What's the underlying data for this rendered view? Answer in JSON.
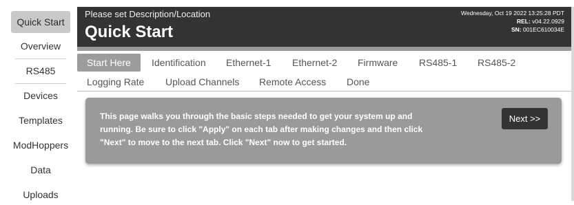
{
  "sidebar": {
    "items": [
      {
        "label": "Quick Start",
        "active": true
      },
      {
        "label": "Overview"
      },
      {
        "label": "RS485"
      },
      {
        "label": "Devices"
      },
      {
        "label": "Templates"
      },
      {
        "label": "ModHoppers"
      },
      {
        "label": "Data"
      },
      {
        "label": "Uploads"
      }
    ]
  },
  "header": {
    "subtitle": "Please set Description/Location",
    "title": "Quick Start",
    "datetime": "Wednesday, Oct 19 2022 13:25:28 PDT",
    "rel_label": "REL:",
    "rel_value": "v04.22.0929",
    "sn_label": "SN:",
    "sn_value": "001EC610034E"
  },
  "tabs": [
    {
      "label": "Start Here",
      "active": true
    },
    {
      "label": "Identification"
    },
    {
      "label": "Ethernet-1"
    },
    {
      "label": "Ethernet-2"
    },
    {
      "label": "Firmware"
    },
    {
      "label": "RS485-1"
    },
    {
      "label": "RS485-2"
    },
    {
      "label": "Logging Rate"
    },
    {
      "label": "Upload Channels"
    },
    {
      "label": "Remote Access"
    },
    {
      "label": "Done"
    }
  ],
  "panel": {
    "line1": "This page walks you through the basic steps needed to get your system up and",
    "line2": "running. Be sure to click \"Apply\" on each tab after making changes and then click",
    "line3": "\"Next\" to move to the next tab. Click \"Next\" now to get started.",
    "next_label": "Next >>"
  },
  "colors": {
    "header_bg": "#333333",
    "panel_bg": "#9a9a9a",
    "active_tab_bg": "#9c9c9c",
    "active_side_bg": "#c9c9c9",
    "button_bg": "#333333"
  }
}
